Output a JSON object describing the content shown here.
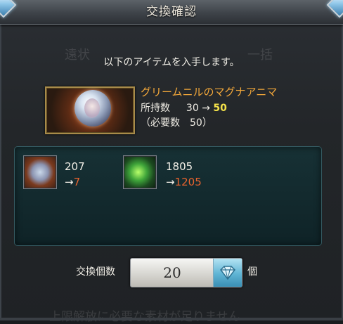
{
  "dialog": {
    "title": "交換確認",
    "message": "以下のアイテムを入手します。",
    "background_ghost_left": "遠状",
    "background_ghost_right": "一括",
    "background_warning": "上限解放に必要な素材が足りません"
  },
  "item": {
    "name": "グリームニルのマグナアニマ",
    "owned_label": "所持数",
    "owned_from": "30",
    "owned_arrow": "→",
    "owned_to": "50",
    "required_text": "（必要数　50）",
    "icon": "magna-anima-orb-icon"
  },
  "costs": [
    {
      "icon": "anima-material-icon",
      "from": "207",
      "arrow": "→",
      "to": "7"
    },
    {
      "icon": "green-material-icon",
      "from": "1805",
      "arrow": "→",
      "to": "1205"
    }
  ],
  "quantity": {
    "label": "交換個数",
    "value": "20",
    "unit": "個",
    "dropdown_icon": "diamond-dropdown-icon"
  },
  "colors": {
    "item_name": "#f2a73a",
    "owned_to": "#f4e24a",
    "cost_to": "#e8632e",
    "panel": "#173135"
  }
}
